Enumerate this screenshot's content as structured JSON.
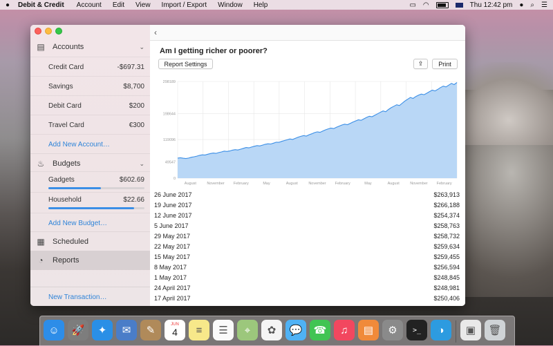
{
  "menubar": {
    "app_name": "Debit & Credit",
    "menus": [
      "Account",
      "Edit",
      "View",
      "Import / Export",
      "Window",
      "Help"
    ],
    "clock": "Thu 12:42 pm"
  },
  "sidebar": {
    "accounts_label": "Accounts",
    "accounts": [
      {
        "name": "Credit Card",
        "value": "-$697.31"
      },
      {
        "name": "Savings",
        "value": "$8,700"
      },
      {
        "name": "Debit Card",
        "value": "$200"
      },
      {
        "name": "Travel Card",
        "value": "€300"
      }
    ],
    "add_account": "Add New Account…",
    "budgets_label": "Budgets",
    "budgets": [
      {
        "name": "Gadgets",
        "value": "$602.69",
        "progress": 0.55
      },
      {
        "name": "Household",
        "value": "$22.66",
        "progress": 0.89
      }
    ],
    "add_budget": "Add New Budget…",
    "scheduled": "Scheduled",
    "reports": "Reports",
    "new_transaction": "New Transaction…"
  },
  "report": {
    "title": "Am I getting richer or poorer?",
    "settings_button": "Report Settings",
    "print_button": "Print",
    "accent": "#3a8ee6"
  },
  "chart_data": {
    "type": "area",
    "y_ticks": [
      "0",
      "49547",
      "119096",
      "198644",
      "298189"
    ],
    "ylim": [
      0,
      298189
    ],
    "x_ticks": [
      "August",
      "November",
      "February",
      "May",
      "August",
      "November",
      "February",
      "May",
      "August",
      "November",
      "February"
    ],
    "grid": true,
    "values": [
      62000,
      63000,
      61500,
      60500,
      62000,
      64500,
      66000,
      68000,
      70500,
      72000,
      71500,
      74000,
      76000,
      77500,
      76500,
      79000,
      81000,
      83500,
      82500,
      84000,
      86500,
      88000,
      87000,
      89500,
      92000,
      94500,
      93500,
      96000,
      98500,
      100500,
      99500,
      102000,
      104500,
      106000,
      105500,
      108000,
      111000,
      110500,
      113500,
      116000,
      118500,
      121000,
      119500,
      123000,
      126500,
      129000,
      131500,
      130000,
      134000,
      137000,
      140500,
      143000,
      141500,
      145500,
      149000,
      152000,
      154500,
      153000,
      157000,
      160500,
      164000,
      166500,
      165000,
      169000,
      173000,
      176500,
      180000,
      178500,
      183000,
      187500,
      191000,
      189500,
      194000,
      198500,
      203000,
      207500,
      205000,
      212000,
      217500,
      222000,
      226500,
      224000,
      231000,
      238000,
      243500,
      249000,
      246000,
      252000,
      256000,
      259500,
      257500,
      262000,
      267000,
      271500,
      269000,
      274000,
      279500,
      284000,
      281500,
      287000,
      292500,
      288500,
      295000
    ]
  },
  "transactions": [
    {
      "date": "26 June 2017",
      "amount": "$263,913"
    },
    {
      "date": "19 June 2017",
      "amount": "$266,188"
    },
    {
      "date": "12 June 2017",
      "amount": "$254,374"
    },
    {
      "date": "5 June 2017",
      "amount": "$258,763"
    },
    {
      "date": "29 May 2017",
      "amount": "$258,732"
    },
    {
      "date": "22 May 2017",
      "amount": "$259,634"
    },
    {
      "date": "15 May 2017",
      "amount": "$259,455"
    },
    {
      "date": "8 May 2017",
      "amount": "$256,594"
    },
    {
      "date": "1 May 2017",
      "amount": "$248,845"
    },
    {
      "date": "24 April 2017",
      "amount": "$248,981"
    },
    {
      "date": "17 April 2017",
      "amount": "$250,406"
    }
  ],
  "dock": {
    "calendar_day": "4",
    "calendar_month": "JUN",
    "icons": [
      {
        "name": "finder",
        "color": "#2d8de8",
        "glyph": "☺"
      },
      {
        "name": "launchpad",
        "color": "#7d7d7d",
        "glyph": "🚀"
      },
      {
        "name": "safari",
        "color": "#2a8fe6",
        "glyph": "✦"
      },
      {
        "name": "preview",
        "color": "#4a7dc8",
        "glyph": "✉"
      },
      {
        "name": "contacts",
        "color": "#b08a5a",
        "glyph": "✎"
      },
      {
        "name": "calendar",
        "color": "#ffffff",
        "glyph": ""
      },
      {
        "name": "notes",
        "color": "#f7e88a",
        "glyph": "≡"
      },
      {
        "name": "reminders",
        "color": "#fafafa",
        "glyph": "☰"
      },
      {
        "name": "maps",
        "color": "#9cc77c",
        "glyph": "⌖"
      },
      {
        "name": "photos",
        "color": "#f4f4f4",
        "glyph": "✿"
      },
      {
        "name": "messages",
        "color": "#4fb2f5",
        "glyph": "💬"
      },
      {
        "name": "facetime",
        "color": "#41c453",
        "glyph": "☎"
      },
      {
        "name": "itunes",
        "color": "#f2475f",
        "glyph": "♫"
      },
      {
        "name": "ibooks",
        "color": "#f08a3a",
        "glyph": "▤"
      },
      {
        "name": "system-preferences",
        "color": "#8a8a8a",
        "glyph": "⚙"
      },
      {
        "name": "terminal",
        "color": "#222222",
        "glyph": ">_"
      },
      {
        "name": "debit-credit",
        "color": "#2d9be0",
        "glyph": "◑"
      }
    ],
    "extra": [
      {
        "name": "downloads",
        "color": "#e9e9e9",
        "glyph": "▣"
      },
      {
        "name": "trash",
        "color": "#cfd3d6",
        "glyph": "🗑"
      }
    ]
  }
}
